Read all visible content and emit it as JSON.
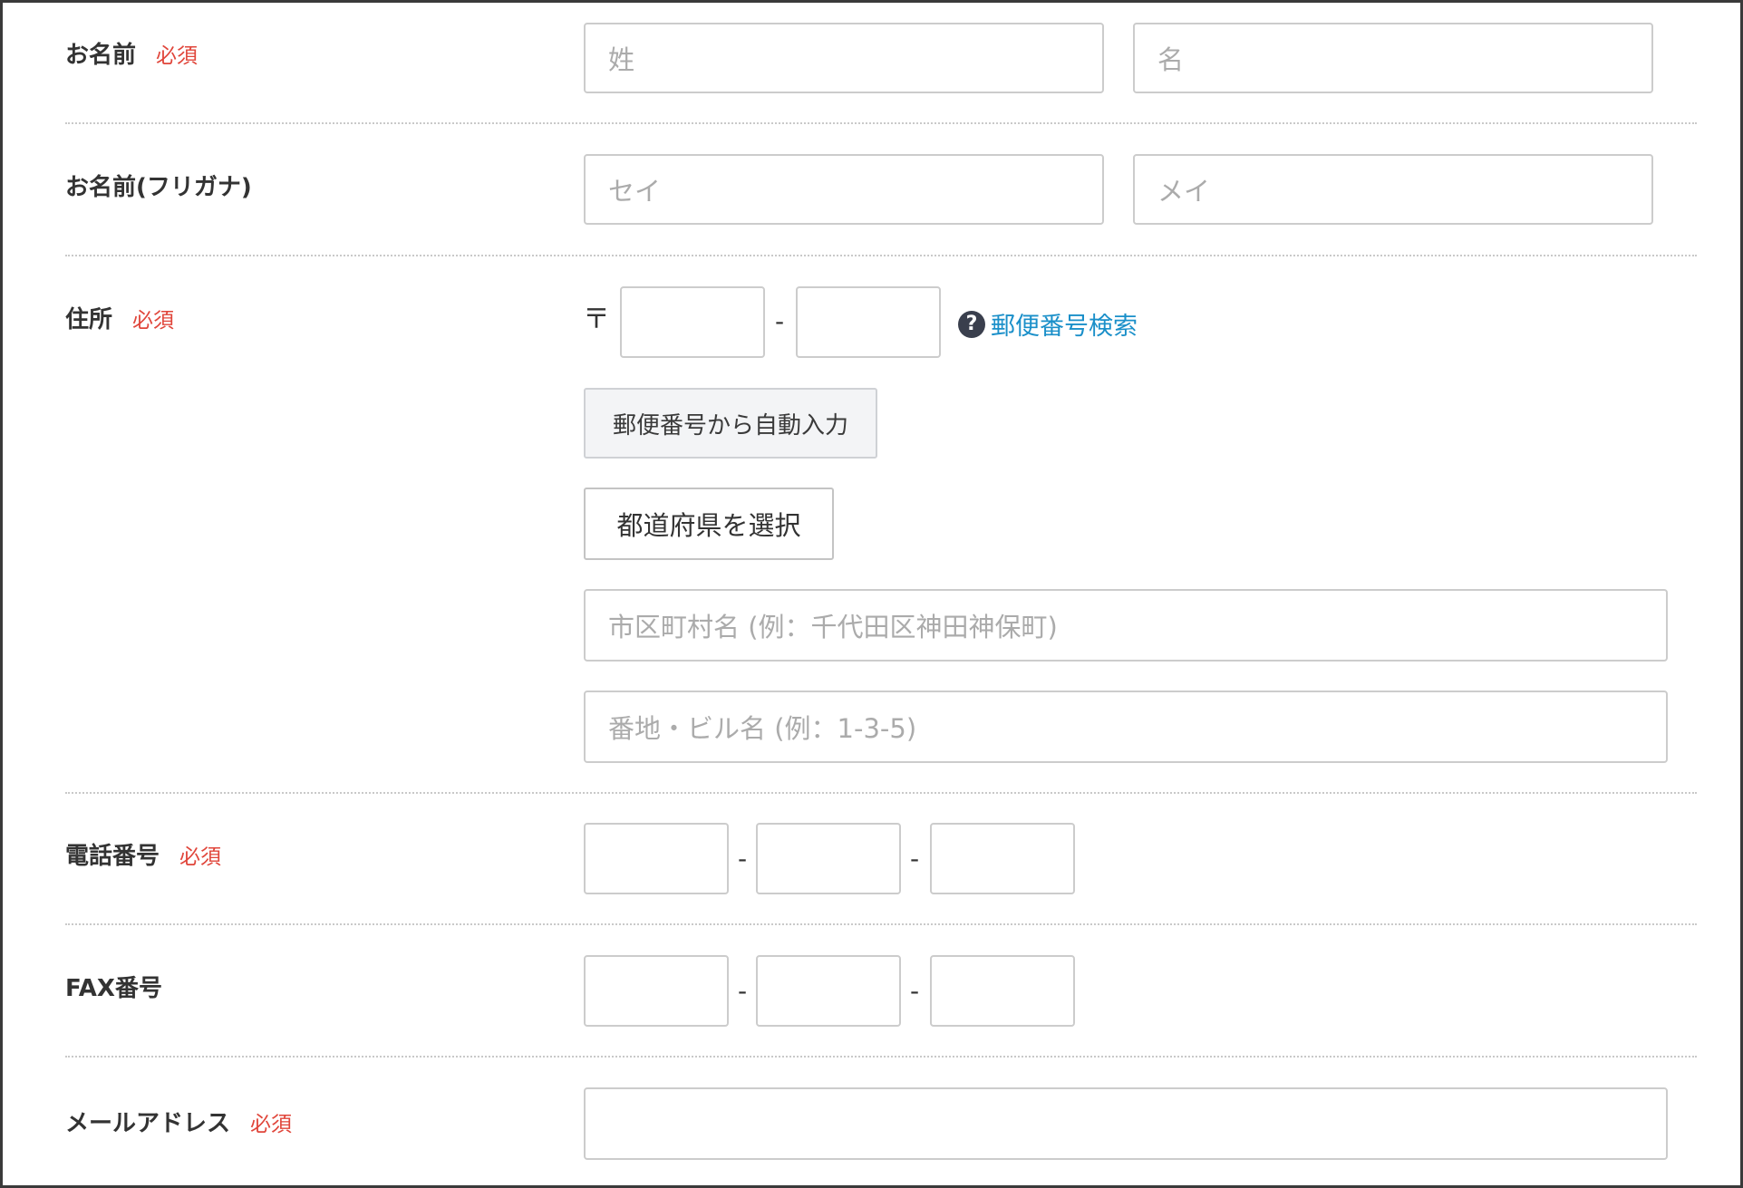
{
  "form": {
    "required_badge": "必須",
    "name": {
      "label": "お名前",
      "last_placeholder": "姓",
      "first_placeholder": "名"
    },
    "kana": {
      "label": "お名前(フリガナ)",
      "last_placeholder": "セイ",
      "first_placeholder": "メイ"
    },
    "address": {
      "label": "住所",
      "postal_mark": "〒",
      "dash": "-",
      "help_link": "郵便番号検索",
      "help_icon": "question-circle",
      "auto_fill_button": "郵便番号から自動入力",
      "prefecture_button": "都道府県を選択",
      "city_placeholder": "市区町村名 (例：千代田区神田神保町)",
      "street_placeholder": "番地・ビル名 (例：1-3-5)"
    },
    "phone": {
      "label": "電話番号",
      "dash": "-"
    },
    "fax": {
      "label": "FAX番号",
      "dash": "-"
    },
    "email": {
      "label": "メールアドレス"
    }
  },
  "colors": {
    "required": "#e0453a",
    "link": "#1a8fc9",
    "border": "#cccccc",
    "placeholder": "#ababab"
  }
}
